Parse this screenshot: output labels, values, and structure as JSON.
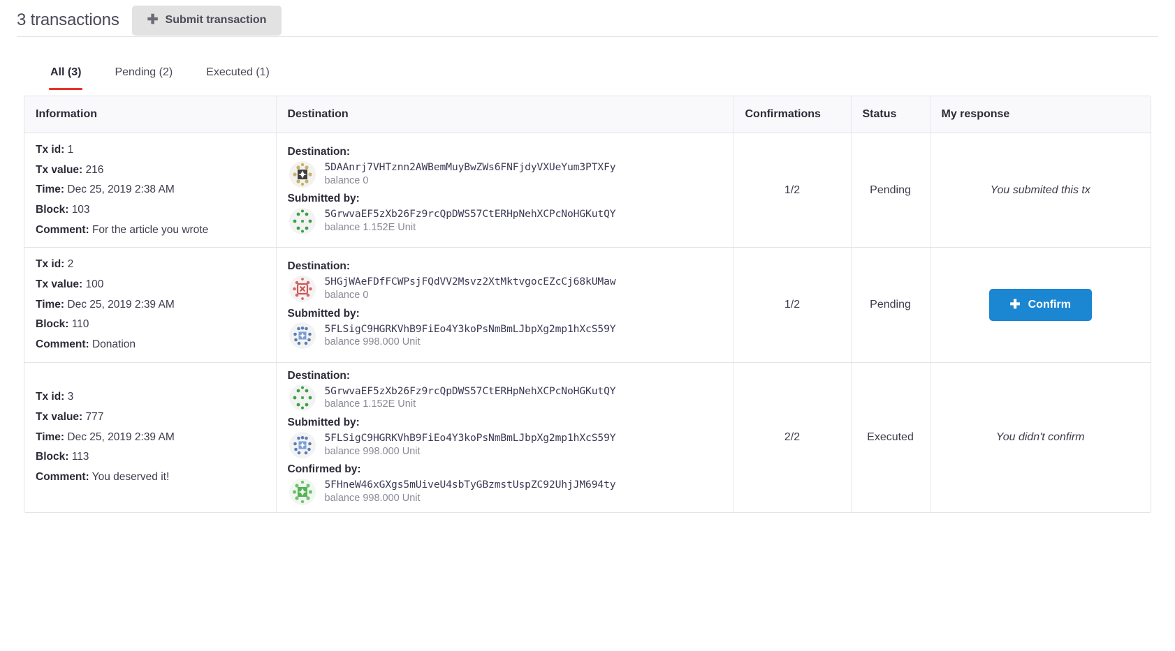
{
  "header": {
    "transaction_count_label": "3 transactions",
    "submit_button_label": "Submit transaction",
    "plus_icon": "plus-icon"
  },
  "tabs": [
    {
      "label": "All (3)",
      "active": true
    },
    {
      "label": "Pending (2)",
      "active": false
    },
    {
      "label": "Executed (1)",
      "active": false
    }
  ],
  "table": {
    "columns": [
      "Information",
      "Destination",
      "Confirmations",
      "Status",
      "My response"
    ],
    "labels": {
      "tx_id": "Tx id:",
      "tx_value": "Tx value:",
      "time": "Time:",
      "block": "Block:",
      "comment": "Comment:",
      "destination": "Destination:",
      "submitted_by": "Submitted by:",
      "confirmed_by": "Confirmed by:"
    },
    "rows": [
      {
        "tx_id": "1",
        "tx_value": "216",
        "time": "Dec 25, 2019 2:38 AM",
        "block": "103",
        "comment": "For the article you wrote",
        "destination": {
          "address": "5DAAnrj7VHTznn2AWBemMuyBwZWs6FNFjdyVXUeYum3PTXFy",
          "balance": "balance 0",
          "identicon": "identicon-gold"
        },
        "submitted_by": {
          "address": "5GrwvaEF5zXb26Fz9rcQpDWS57CtERHpNehXCPcNoHGKutQY",
          "balance": "balance 1.152E Unit",
          "identicon": "identicon-green"
        },
        "confirmed_by": null,
        "confirmations": "1/2",
        "status": "Pending",
        "response_type": "text",
        "response_text": "You submited this tx"
      },
      {
        "tx_id": "2",
        "tx_value": "100",
        "time": "Dec 25, 2019 2:39 AM",
        "block": "110",
        "comment": "Donation",
        "destination": {
          "address": "5HGjWAeFDfFCWPsjFQdVV2Msvz2XtMktvgocEZcCj68kUMaw",
          "balance": "balance 0",
          "identicon": "identicon-red"
        },
        "submitted_by": {
          "address": "5FLSigC9HGRKVhB9FiEo4Y3koPsNmBmLJbpXg2mp1hXcS59Y",
          "balance": "balance 998.000 Unit",
          "identicon": "identicon-blue"
        },
        "confirmed_by": null,
        "confirmations": "1/2",
        "status": "Pending",
        "response_type": "button",
        "response_button_label": "Confirm"
      },
      {
        "tx_id": "3",
        "tx_value": "777",
        "time": "Dec 25, 2019 2:39 AM",
        "block": "113",
        "comment": "You deserved it!",
        "destination": {
          "address": "5GrwvaEF5zXb26Fz9rcQpDWS57CtERHpNehXCPcNoHGKutQY",
          "balance": "balance 1.152E Unit",
          "identicon": "identicon-green"
        },
        "submitted_by": {
          "address": "5FLSigC9HGRKVhB9FiEo4Y3koPsNmBmLJbpXg2mp1hXcS59Y",
          "balance": "balance 998.000 Unit",
          "identicon": "identicon-blue"
        },
        "confirmed_by": {
          "address": "5FHneW46xGXgs5mUiveU4sbTyGBzmstUspZC92UhjJM694ty",
          "balance": "balance 998.000 Unit",
          "identicon": "identicon-lightgreen"
        },
        "confirmations": "2/2",
        "status": "Executed",
        "response_type": "text",
        "response_text": "You didn't confirm"
      }
    ]
  },
  "colors": {
    "accent_tab_underline": "#e6342c",
    "confirm_button": "#1b86d1",
    "submit_button": "#e2e2e2",
    "border": "#e3e3e8",
    "header_bg": "#f9f9fb"
  }
}
